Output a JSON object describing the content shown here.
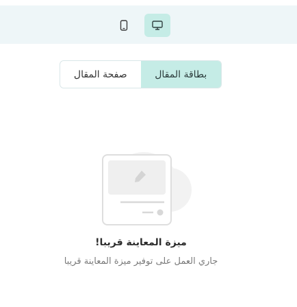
{
  "device_toggle": {
    "mobile_icon": "mobile-phone-icon",
    "desktop_icon": "monitor-icon",
    "active": "desktop"
  },
  "tabs": [
    {
      "label": "بطاقة المقال",
      "active": true
    },
    {
      "label": "صفحة المقال",
      "active": false
    }
  ],
  "empty_state": {
    "icon": "image-placeholder-icon",
    "title": "ميزة المعاينة قريبا!",
    "subtitle": "جاري العمل على توفير ميزة المعاينة قريبا"
  },
  "colors": {
    "accent": "#c5ece6",
    "topbar_bg": "#eef6f8"
  }
}
